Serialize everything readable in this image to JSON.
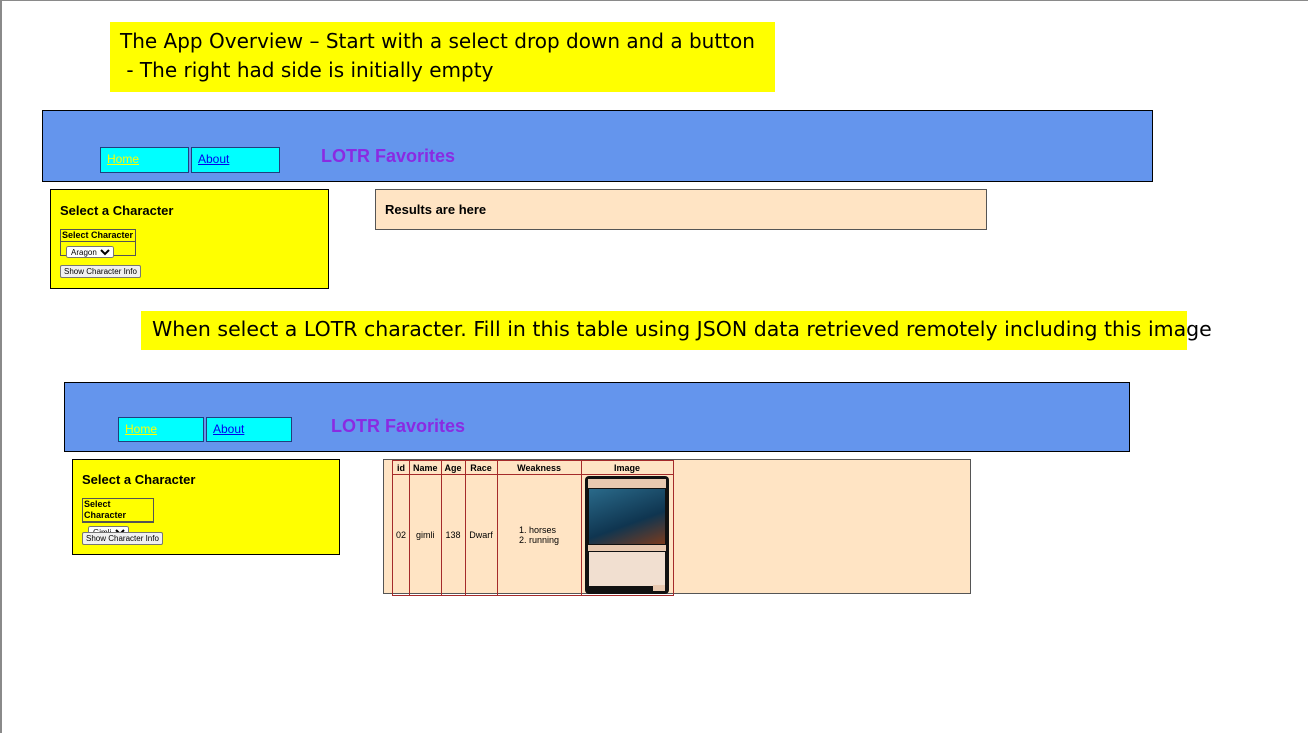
{
  "callout_top": {
    "line1": "The App Overview – Start with a select drop down and a button",
    "line2": " - The right had side is initially empty"
  },
  "callout_middle": "When select a LOTR character. Fill in this table using JSON data retrieved remotely including this image",
  "app_initial": {
    "nav": {
      "home_label": "Home",
      "about_label": "About",
      "title": "LOTR Favorites"
    },
    "select_panel": {
      "heading": "Select a Character",
      "select_label": "Select Character",
      "selected_value": "Aragon",
      "button_label": "Show Character Info"
    },
    "results_text": "Results are here"
  },
  "app_filled": {
    "nav": {
      "home_label": "Home",
      "about_label": "About",
      "title": "LOTR Favorites"
    },
    "select_panel": {
      "heading": "Select a Character",
      "select_label": "Select Character",
      "selected_value": "Gimli",
      "button_label": "Show Character Info"
    },
    "table": {
      "headers": [
        "id",
        "Name",
        "Age",
        "Race",
        "Weakness",
        "Image"
      ],
      "row": {
        "id": "02",
        "name": "gimli",
        "age": "138",
        "race": "Dwarf",
        "weaknesses": [
          "horses",
          "running"
        ],
        "image": "gimli-card-image"
      }
    }
  },
  "colors": {
    "callout": "#ffff00",
    "navbar": "#6495ed",
    "navlink": "#00ffff",
    "title": "#8a2be2",
    "results": "#ffe4c4"
  }
}
